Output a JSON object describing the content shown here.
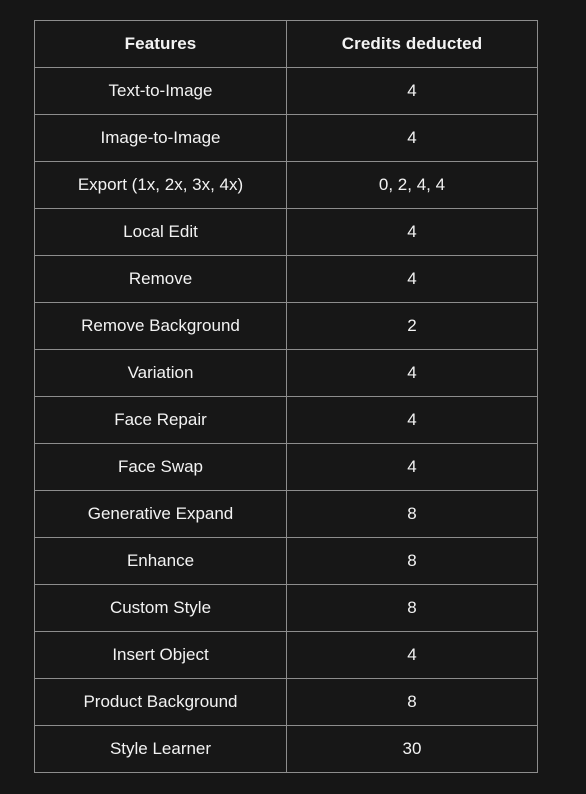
{
  "theme": {
    "page_background": "#161616",
    "cell_background": "#171717",
    "border_color": "#8d8d8d",
    "text_color": "#f3f3f3"
  },
  "table": {
    "columns": [
      {
        "key": "feature",
        "label": "Features"
      },
      {
        "key": "credits",
        "label": "Credits deducted"
      }
    ],
    "rows": [
      {
        "feature": "Text-to-Image",
        "credits": "4"
      },
      {
        "feature": "Image-to-Image",
        "credits": "4"
      },
      {
        "feature": "Export (1x, 2x, 3x, 4x)",
        "credits": "0, 2, 4, 4"
      },
      {
        "feature": "Local Edit",
        "credits": "4"
      },
      {
        "feature": "Remove",
        "credits": "4"
      },
      {
        "feature": "Remove Background",
        "credits": "2"
      },
      {
        "feature": "Variation",
        "credits": "4"
      },
      {
        "feature": "Face Repair",
        "credits": "4"
      },
      {
        "feature": "Face Swap",
        "credits": "4"
      },
      {
        "feature": "Generative Expand",
        "credits": "8"
      },
      {
        "feature": "Enhance",
        "credits": "8"
      },
      {
        "feature": "Custom Style",
        "credits": "8"
      },
      {
        "feature": "Insert Object",
        "credits": "4"
      },
      {
        "feature": "Product Background",
        "credits": "8"
      },
      {
        "feature": "Style Learner",
        "credits": "30"
      }
    ]
  }
}
